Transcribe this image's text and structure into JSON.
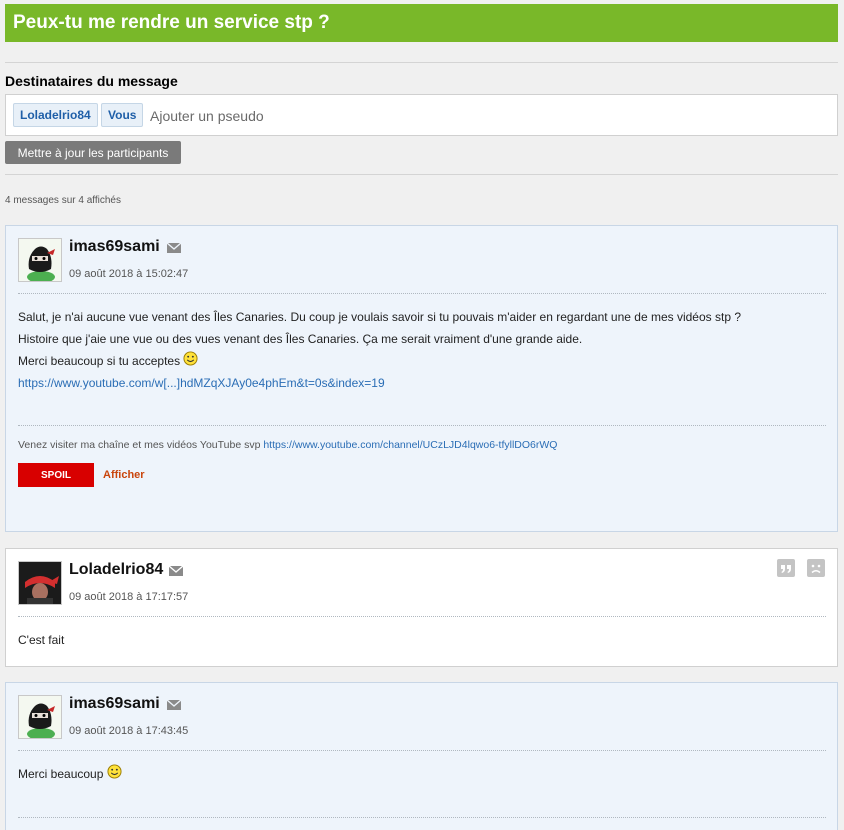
{
  "page_title": "Peux-tu me rendre un service stp ?",
  "recipients": {
    "label": "Destinataires du message",
    "chips": [
      "Loladelrio84",
      "Vous"
    ],
    "placeholder": "Ajouter un pseudo",
    "update_button": "Mettre à jour les participants"
  },
  "messages_count": "4 messages sur 4 affichés",
  "messages": [
    {
      "author": "imas69sami",
      "date": "09 août 2018 à 15:02:47",
      "lines": [
        "Salut, je n'ai aucune vue venant des Îles Canaries. Du coup je voulais savoir si tu pouvais m'aider en regardant une de mes vidéos stp ?",
        "Histoire que j'aie une vue ou des vues venant des Îles Canaries. Ça me serait vraiment d'une grande aide.",
        "Merci beaucoup si tu acceptes"
      ],
      "link": "https://www.youtube.com/w[...]hdMZqXJAy0e4phEm&t=0s&index=19",
      "signature_text": "Venez visiter ma chaîne et mes vidéos YouTube svp",
      "signature_link": "https://www.youtube.com/channel/UCzLJD4lqwo6-tfyllDO6rWQ",
      "spoil_label": "SPOIL",
      "show_label": "Afficher"
    },
    {
      "author": "Loladelrio84",
      "date": "09 août 2018 à 17:17:57",
      "text": "C'est fait"
    },
    {
      "author": "imas69sami",
      "date": "09 août 2018 à 17:43:45",
      "text": "Merci beaucoup"
    }
  ],
  "icons": {
    "mail": "envelope-icon",
    "quote": "quote-icon",
    "report": "sad-face-icon",
    "smiley": "smiley-icon"
  },
  "colors": {
    "title_bar": "#79b829",
    "message_bg": "#eef4fb",
    "spoil_button": "#d80000",
    "show_link": "#c9450c",
    "link": "#2a6db5"
  }
}
